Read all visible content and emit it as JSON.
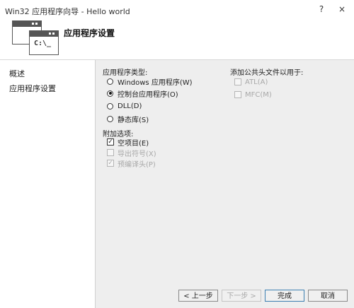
{
  "window": {
    "title": "Win32 应用程序向导 - Hello world",
    "help_glyph": "?",
    "close_glyph": "×"
  },
  "header": {
    "title": "应用程序设置",
    "icon_prompt": "C:\\_"
  },
  "nav": {
    "items": [
      "概述",
      "应用程序设置"
    ]
  },
  "app_type": {
    "label": "应用程序类型:",
    "options": [
      {
        "label": "Windows 应用程序(W)",
        "checked": false
      },
      {
        "label": "控制台应用程序(O)",
        "checked": true
      },
      {
        "label": "DLL(D)",
        "checked": false
      },
      {
        "label": "静态库(S)",
        "checked": false
      }
    ]
  },
  "extra": {
    "label": "附加选项:",
    "options": [
      {
        "label": "空项目(E)",
        "checked": true,
        "enabled": true
      },
      {
        "label": "导出符号(X)",
        "checked": false,
        "enabled": false
      },
      {
        "label": "预编译头(P)",
        "checked": true,
        "enabled": false
      }
    ]
  },
  "headers": {
    "label": "添加公共头文件以用于:",
    "options": [
      {
        "label": "ATL(A)",
        "checked": false,
        "enabled": false
      },
      {
        "label": "MFC(M)",
        "checked": false,
        "enabled": false
      }
    ]
  },
  "buttons": {
    "prev": "< 上一步",
    "next": "下一步 >",
    "finish": "完成",
    "cancel": "取消"
  },
  "check_glyph": "✓"
}
